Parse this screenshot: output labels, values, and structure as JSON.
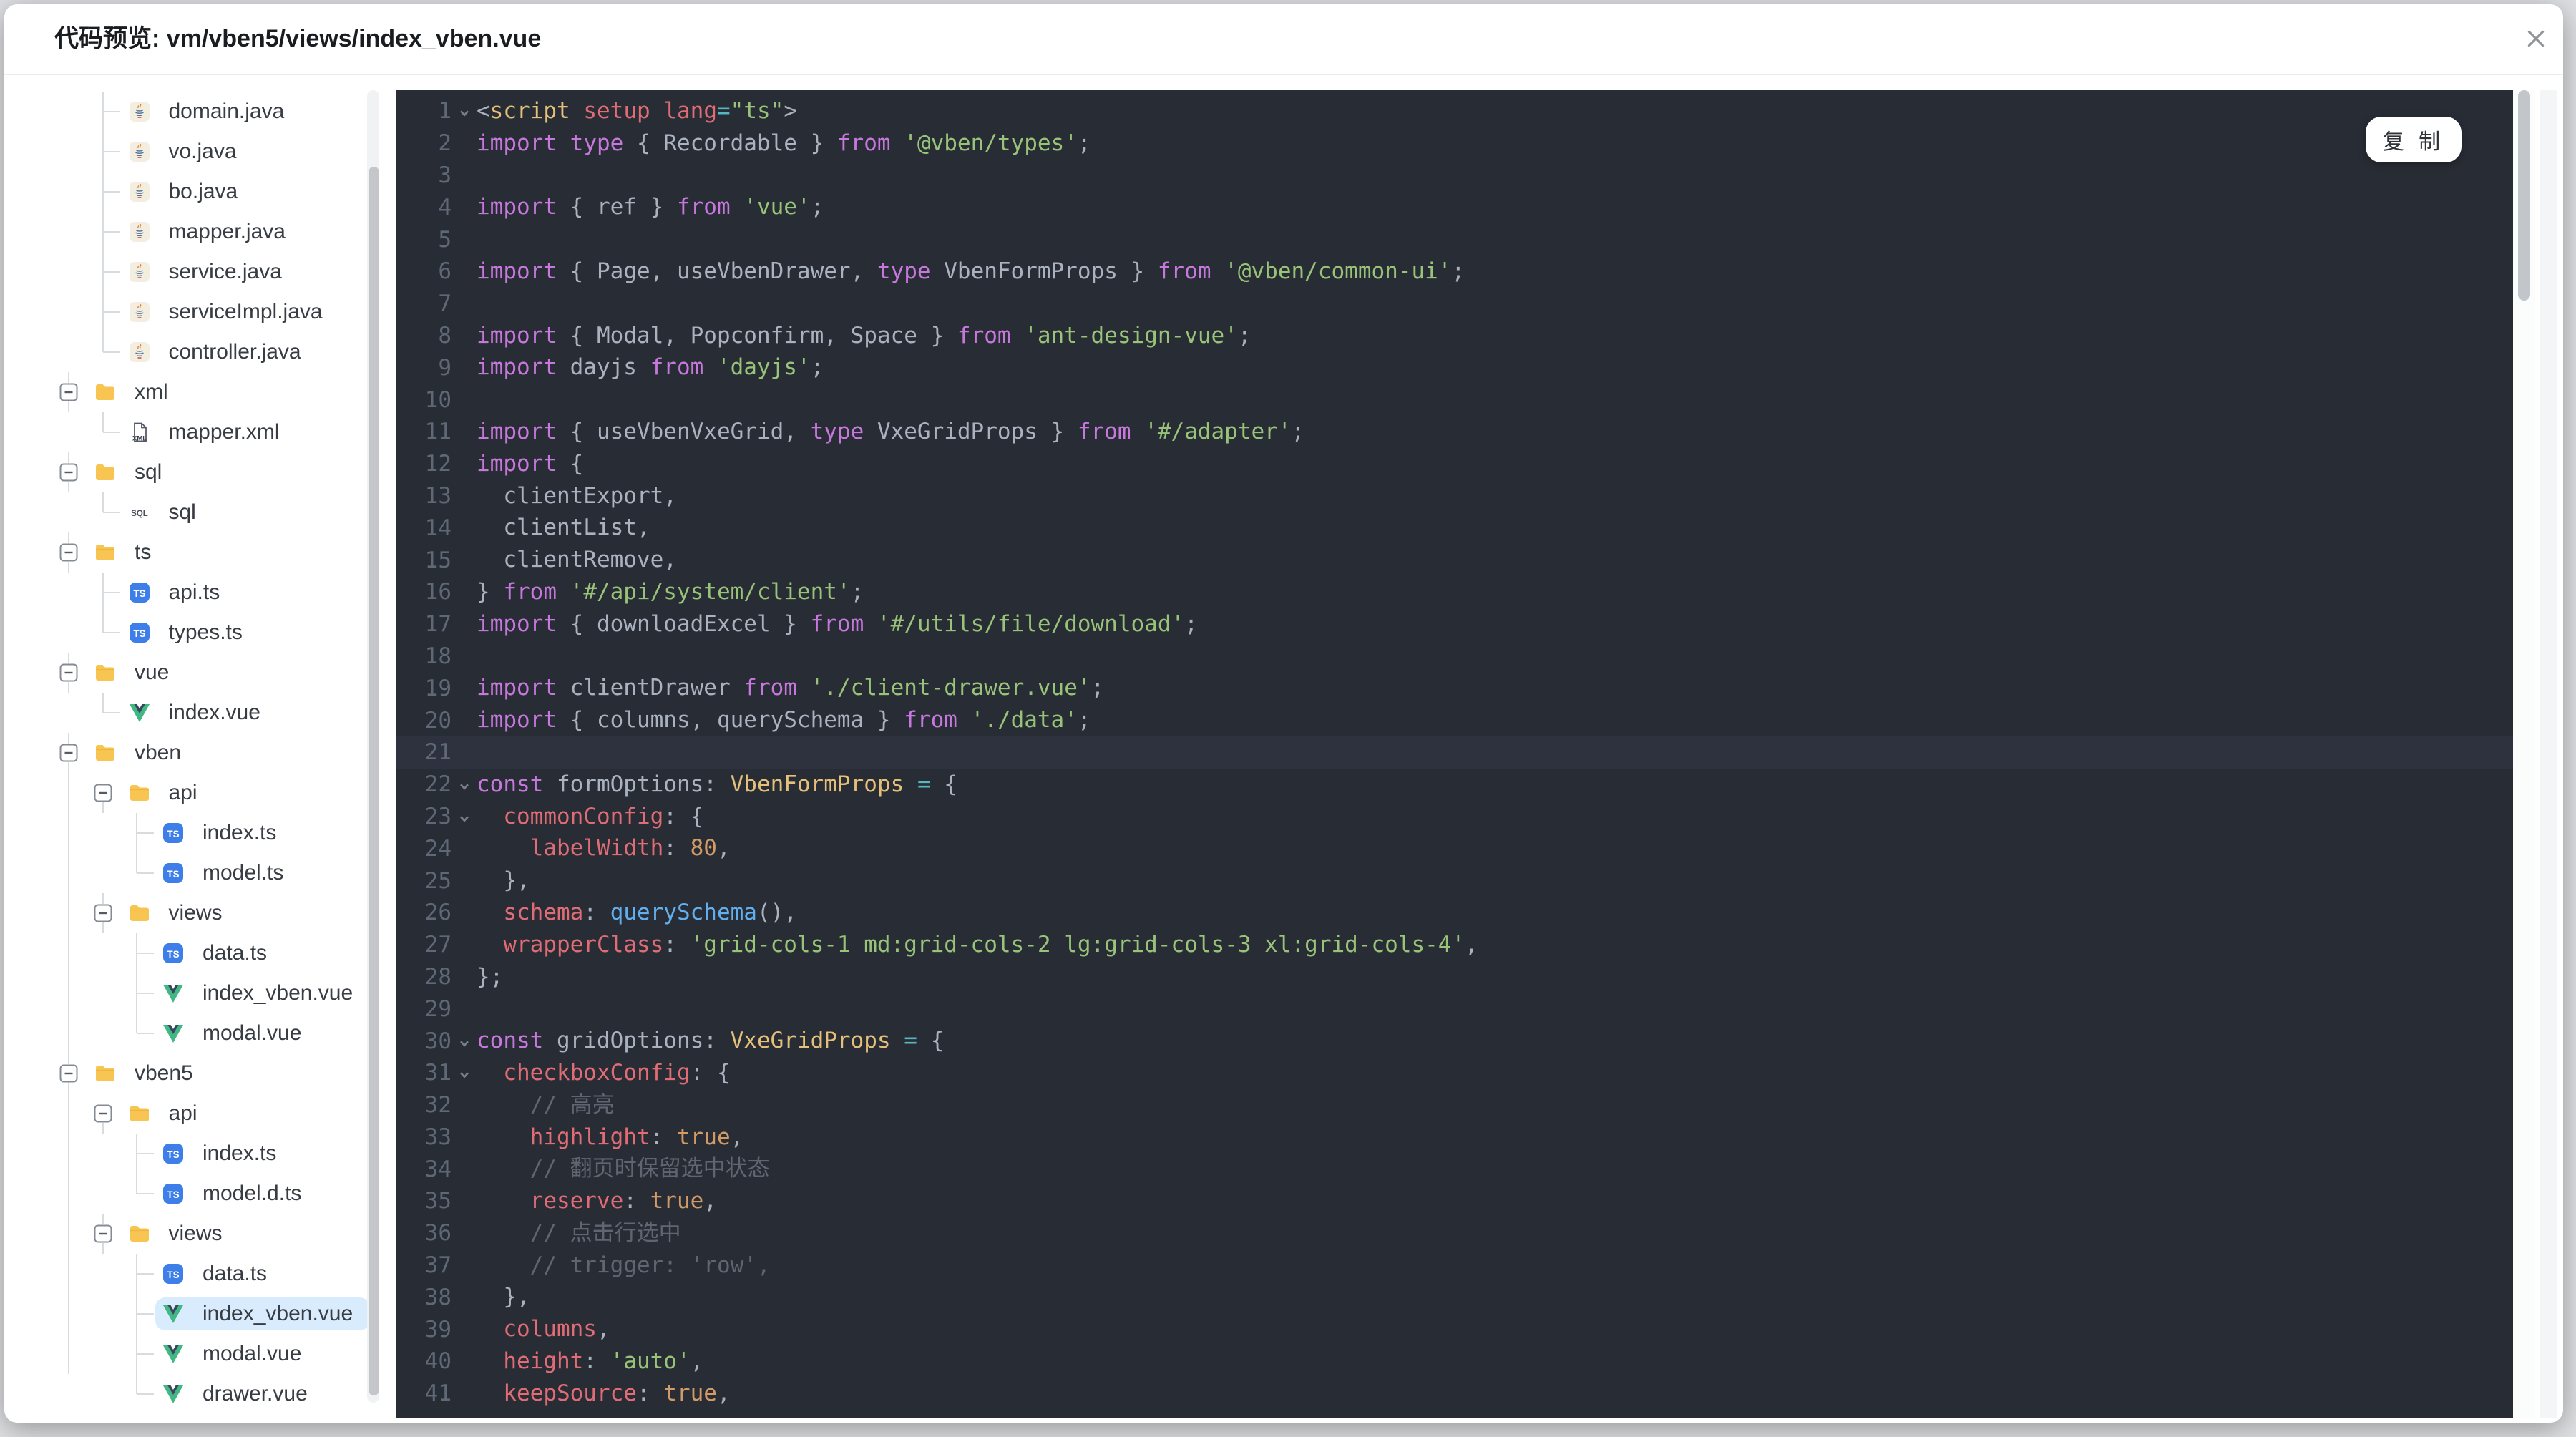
{
  "dialog": {
    "title": "代码预览: vm/vben5/views/index_vben.vue",
    "close_icon": "close-x-icon"
  },
  "editor": {
    "copy_button_label": "复 制",
    "current_line": 21,
    "fold_lines": [
      1,
      22,
      23,
      30,
      31
    ],
    "lines": [
      {
        "n": 1,
        "t": [
          [
            "p",
            "<"
          ],
          [
            "t",
            "script"
          ],
          [
            "p",
            " "
          ],
          [
            "r",
            "setup"
          ],
          [
            "p",
            " "
          ],
          [
            "r",
            "lang"
          ],
          [
            "o",
            "="
          ],
          [
            "s",
            "\"ts\""
          ],
          [
            "p",
            ">"
          ]
        ]
      },
      {
        "n": 2,
        "t": [
          [
            "k",
            "import"
          ],
          [
            "p",
            " "
          ],
          [
            "k",
            "type"
          ],
          [
            "p",
            " { Recordable } "
          ],
          [
            "k",
            "from"
          ],
          [
            "p",
            " "
          ],
          [
            "s",
            "'@vben/types'"
          ],
          [
            "p",
            ";"
          ]
        ]
      },
      {
        "n": 3,
        "t": []
      },
      {
        "n": 4,
        "t": [
          [
            "k",
            "import"
          ],
          [
            "p",
            " { ref } "
          ],
          [
            "k",
            "from"
          ],
          [
            "p",
            " "
          ],
          [
            "s",
            "'vue'"
          ],
          [
            "p",
            ";"
          ]
        ]
      },
      {
        "n": 5,
        "t": []
      },
      {
        "n": 6,
        "t": [
          [
            "k",
            "import"
          ],
          [
            "p",
            " { Page, useVbenDrawer, "
          ],
          [
            "k",
            "type"
          ],
          [
            "p",
            " VbenFormProps } "
          ],
          [
            "k",
            "from"
          ],
          [
            "p",
            " "
          ],
          [
            "s",
            "'@vben/common-ui'"
          ],
          [
            "p",
            ";"
          ]
        ]
      },
      {
        "n": 7,
        "t": []
      },
      {
        "n": 8,
        "t": [
          [
            "k",
            "import"
          ],
          [
            "p",
            " { Modal, Popconfirm, Space } "
          ],
          [
            "k",
            "from"
          ],
          [
            "p",
            " "
          ],
          [
            "s",
            "'ant-design-vue'"
          ],
          [
            "p",
            ";"
          ]
        ]
      },
      {
        "n": 9,
        "t": [
          [
            "k",
            "import"
          ],
          [
            "p",
            " dayjs "
          ],
          [
            "k",
            "from"
          ],
          [
            "p",
            " "
          ],
          [
            "s",
            "'dayjs'"
          ],
          [
            "p",
            ";"
          ]
        ]
      },
      {
        "n": 10,
        "t": []
      },
      {
        "n": 11,
        "t": [
          [
            "k",
            "import"
          ],
          [
            "p",
            " { useVbenVxeGrid, "
          ],
          [
            "k",
            "type"
          ],
          [
            "p",
            " VxeGridProps } "
          ],
          [
            "k",
            "from"
          ],
          [
            "p",
            " "
          ],
          [
            "s",
            "'#/adapter'"
          ],
          [
            "p",
            ";"
          ]
        ]
      },
      {
        "n": 12,
        "t": [
          [
            "k",
            "import"
          ],
          [
            "p",
            " {"
          ]
        ]
      },
      {
        "n": 13,
        "t": [
          [
            "p",
            "  clientExport,"
          ]
        ]
      },
      {
        "n": 14,
        "t": [
          [
            "p",
            "  clientList,"
          ]
        ]
      },
      {
        "n": 15,
        "t": [
          [
            "p",
            "  clientRemove,"
          ]
        ]
      },
      {
        "n": 16,
        "t": [
          [
            "p",
            "} "
          ],
          [
            "k",
            "from"
          ],
          [
            "p",
            " "
          ],
          [
            "s",
            "'#/api/system/client'"
          ],
          [
            "p",
            ";"
          ]
        ]
      },
      {
        "n": 17,
        "t": [
          [
            "k",
            "import"
          ],
          [
            "p",
            " { downloadExcel } "
          ],
          [
            "k",
            "from"
          ],
          [
            "p",
            " "
          ],
          [
            "s",
            "'#/utils/file/download'"
          ],
          [
            "p",
            ";"
          ]
        ]
      },
      {
        "n": 18,
        "t": []
      },
      {
        "n": 19,
        "t": [
          [
            "k",
            "import"
          ],
          [
            "p",
            " clientDrawer "
          ],
          [
            "k",
            "from"
          ],
          [
            "p",
            " "
          ],
          [
            "s",
            "'./client-drawer.vue'"
          ],
          [
            "p",
            ";"
          ]
        ]
      },
      {
        "n": 20,
        "t": [
          [
            "k",
            "import"
          ],
          [
            "p",
            " { columns, querySchema } "
          ],
          [
            "k",
            "from"
          ],
          [
            "p",
            " "
          ],
          [
            "s",
            "'./data'"
          ],
          [
            "p",
            ";"
          ]
        ]
      },
      {
        "n": 21,
        "t": []
      },
      {
        "n": 22,
        "t": [
          [
            "k",
            "const"
          ],
          [
            "p",
            " formOptions: "
          ],
          [
            "y",
            "VbenFormProps"
          ],
          [
            "p",
            " "
          ],
          [
            "o",
            "="
          ],
          [
            "p",
            " {"
          ]
        ]
      },
      {
        "n": 23,
        "t": [
          [
            "p",
            "  "
          ],
          [
            "r",
            "commonConfig"
          ],
          [
            "p",
            ": {"
          ]
        ]
      },
      {
        "n": 24,
        "t": [
          [
            "p",
            "    "
          ],
          [
            "r",
            "labelWidth"
          ],
          [
            "p",
            ": "
          ],
          [
            "n",
            "80"
          ],
          [
            "p",
            ","
          ]
        ]
      },
      {
        "n": 25,
        "t": [
          [
            "p",
            "  },"
          ]
        ]
      },
      {
        "n": 26,
        "t": [
          [
            "p",
            "  "
          ],
          [
            "r",
            "schema"
          ],
          [
            "p",
            ": "
          ],
          [
            "f",
            "querySchema"
          ],
          [
            "p",
            "(),"
          ]
        ]
      },
      {
        "n": 27,
        "t": [
          [
            "p",
            "  "
          ],
          [
            "r",
            "wrapperClass"
          ],
          [
            "p",
            ": "
          ],
          [
            "s",
            "'grid-cols-1 md:grid-cols-2 lg:grid-cols-3 xl:grid-cols-4'"
          ],
          [
            "p",
            ","
          ]
        ]
      },
      {
        "n": 28,
        "t": [
          [
            "p",
            "};"
          ]
        ]
      },
      {
        "n": 29,
        "t": []
      },
      {
        "n": 30,
        "t": [
          [
            "k",
            "const"
          ],
          [
            "p",
            " gridOptions: "
          ],
          [
            "y",
            "VxeGridProps"
          ],
          [
            "p",
            " "
          ],
          [
            "o",
            "="
          ],
          [
            "p",
            " {"
          ]
        ]
      },
      {
        "n": 31,
        "t": [
          [
            "p",
            "  "
          ],
          [
            "r",
            "checkboxConfig"
          ],
          [
            "p",
            ": {"
          ]
        ]
      },
      {
        "n": 32,
        "t": [
          [
            "p",
            "    "
          ],
          [
            "c",
            "// 高亮"
          ]
        ]
      },
      {
        "n": 33,
        "t": [
          [
            "p",
            "    "
          ],
          [
            "r",
            "highlight"
          ],
          [
            "p",
            ": "
          ],
          [
            "n",
            "true"
          ],
          [
            "p",
            ","
          ]
        ]
      },
      {
        "n": 34,
        "t": [
          [
            "p",
            "    "
          ],
          [
            "c",
            "// 翻页时保留选中状态"
          ]
        ]
      },
      {
        "n": 35,
        "t": [
          [
            "p",
            "    "
          ],
          [
            "r",
            "reserve"
          ],
          [
            "p",
            ": "
          ],
          [
            "n",
            "true"
          ],
          [
            "p",
            ","
          ]
        ]
      },
      {
        "n": 36,
        "t": [
          [
            "p",
            "    "
          ],
          [
            "c",
            "// 点击行选中"
          ]
        ]
      },
      {
        "n": 37,
        "t": [
          [
            "p",
            "    "
          ],
          [
            "c",
            "// trigger: 'row',"
          ]
        ]
      },
      {
        "n": 38,
        "t": [
          [
            "p",
            "  },"
          ]
        ]
      },
      {
        "n": 39,
        "t": [
          [
            "p",
            "  "
          ],
          [
            "r",
            "columns"
          ],
          [
            "p",
            ","
          ]
        ]
      },
      {
        "n": 40,
        "t": [
          [
            "p",
            "  "
          ],
          [
            "r",
            "height"
          ],
          [
            "p",
            ": "
          ],
          [
            "s",
            "'auto'"
          ],
          [
            "p",
            ","
          ]
        ]
      },
      {
        "n": 41,
        "t": [
          [
            "p",
            "  "
          ],
          [
            "r",
            "keepSource"
          ],
          [
            "p",
            ": "
          ],
          [
            "n",
            "true"
          ],
          [
            "p",
            ","
          ]
        ]
      }
    ]
  },
  "tree": {
    "items": [
      {
        "label": "domain.java",
        "icon": "java",
        "depth": 1
      },
      {
        "label": "vo.java",
        "icon": "java",
        "depth": 1
      },
      {
        "label": "bo.java",
        "icon": "java",
        "depth": 1
      },
      {
        "label": "mapper.java",
        "icon": "java",
        "depth": 1
      },
      {
        "label": "service.java",
        "icon": "java",
        "depth": 1
      },
      {
        "label": "serviceImpl.java",
        "icon": "java",
        "depth": 1
      },
      {
        "label": "controller.java",
        "icon": "java",
        "depth": 1
      },
      {
        "label": "xml",
        "icon": "folder",
        "depth": 0,
        "folder": true
      },
      {
        "label": "mapper.xml",
        "icon": "xml",
        "depth": 1
      },
      {
        "label": "sql",
        "icon": "folder",
        "depth": 0,
        "folder": true
      },
      {
        "label": "sql",
        "icon": "sql",
        "depth": 1
      },
      {
        "label": "ts",
        "icon": "folder",
        "depth": 0,
        "folder": true
      },
      {
        "label": "api.ts",
        "icon": "ts",
        "depth": 1
      },
      {
        "label": "types.ts",
        "icon": "ts",
        "depth": 1
      },
      {
        "label": "vue",
        "icon": "folder",
        "depth": 0,
        "folder": true
      },
      {
        "label": "index.vue",
        "icon": "vue",
        "depth": 1
      },
      {
        "label": "vben",
        "icon": "folder",
        "depth": 0,
        "folder": true
      },
      {
        "label": "api",
        "icon": "folder",
        "depth": 1,
        "folder": true
      },
      {
        "label": "index.ts",
        "icon": "ts",
        "depth": 2
      },
      {
        "label": "model.ts",
        "icon": "ts",
        "depth": 2
      },
      {
        "label": "views",
        "icon": "folder",
        "depth": 1,
        "folder": true
      },
      {
        "label": "data.ts",
        "icon": "ts",
        "depth": 2
      },
      {
        "label": "index_vben.vue",
        "icon": "vue",
        "depth": 2
      },
      {
        "label": "modal.vue",
        "icon": "vue",
        "depth": 2
      },
      {
        "label": "vben5",
        "icon": "folder",
        "depth": 0,
        "folder": true
      },
      {
        "label": "api",
        "icon": "folder",
        "depth": 1,
        "folder": true
      },
      {
        "label": "index.ts",
        "icon": "ts",
        "depth": 2
      },
      {
        "label": "model.d.ts",
        "icon": "ts",
        "depth": 2
      },
      {
        "label": "views",
        "icon": "folder",
        "depth": 1,
        "folder": true
      },
      {
        "label": "data.ts",
        "icon": "ts",
        "depth": 2
      },
      {
        "label": "index_vben.vue",
        "icon": "vue",
        "depth": 2,
        "selected": true
      },
      {
        "label": "modal.vue",
        "icon": "vue",
        "depth": 2
      },
      {
        "label": "drawer.vue",
        "icon": "vue",
        "depth": 2
      }
    ]
  },
  "colors": {
    "editor_bg": "#282c34",
    "editor_current_line": "#2d323e",
    "keyword": "#c678dd",
    "string": "#98c379",
    "property": "#e06c75",
    "number_bool": "#d19a66",
    "type": "#e5c07b",
    "function": "#61afef",
    "operator": "#56b6c2",
    "comment": "#5f6672",
    "line_number": "#5e6876",
    "selected_tree_item_bg": "#d9ecfd",
    "folder": "#f8c552",
    "ts_badge": "#3d7ee9",
    "vue_green": "#41b883",
    "vue_dark": "#35495e"
  }
}
